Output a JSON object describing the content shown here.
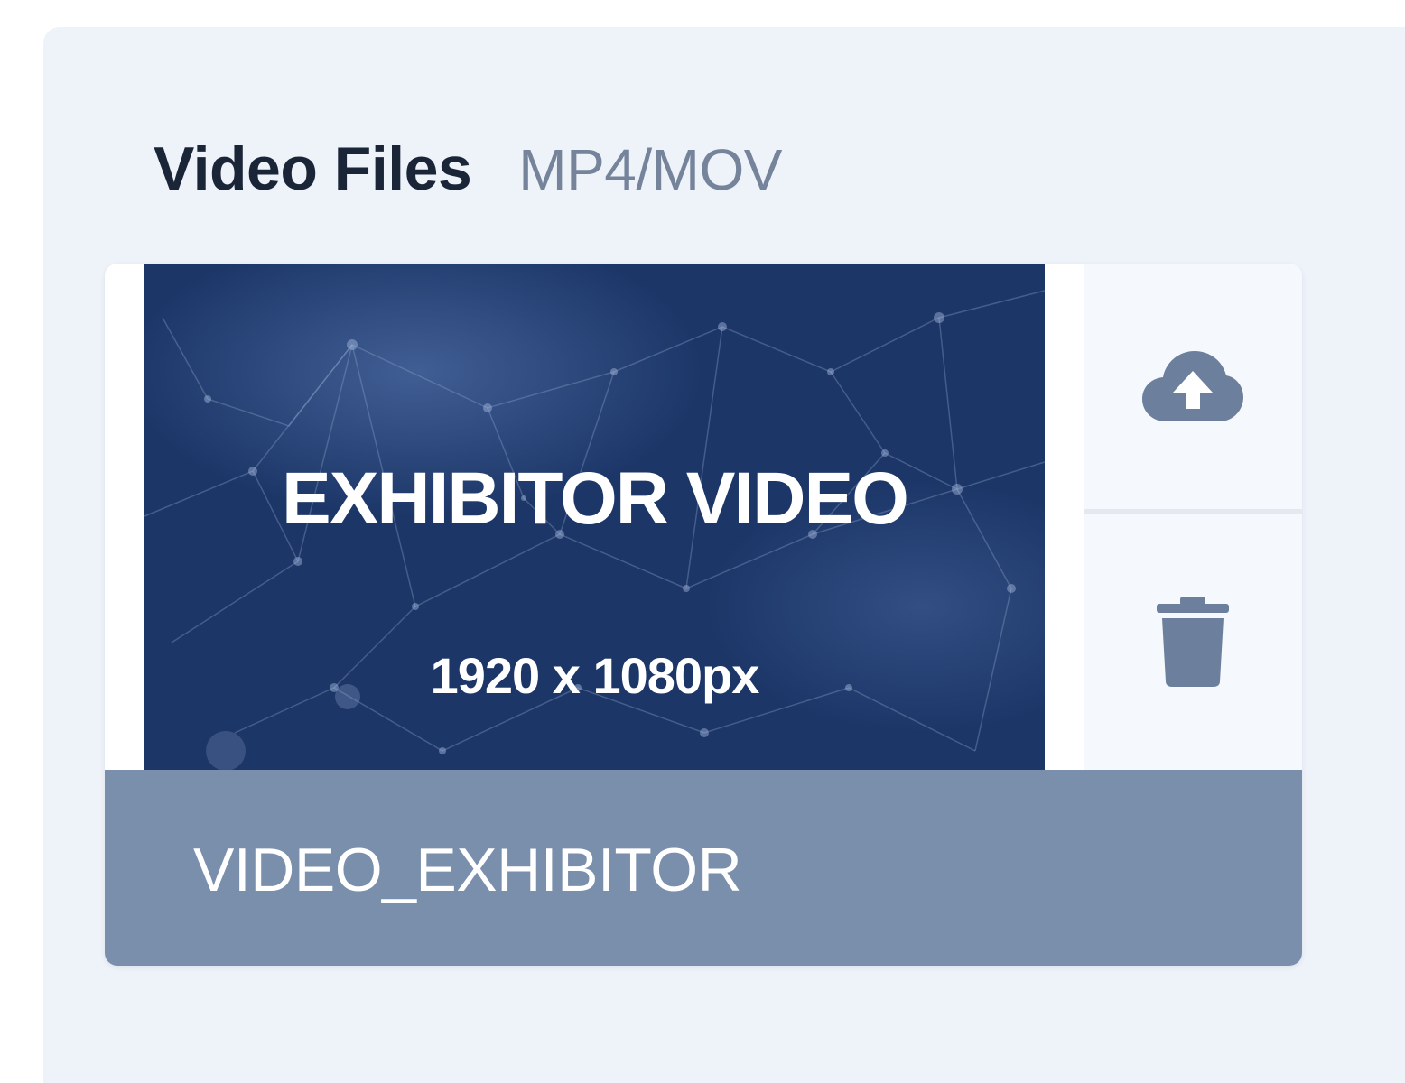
{
  "section": {
    "title": "Video Files",
    "formats": "MP4/MOV"
  },
  "file": {
    "thumbnail_title": "EXHIBITOR VIDEO",
    "thumbnail_resolution": "1920 x 1080px",
    "name": "VIDEO_EXHIBITOR"
  },
  "actions": {
    "upload_icon": "cloud-upload-icon",
    "delete_icon": "trash-icon"
  },
  "colors": {
    "panel_bg": "#eef2f9",
    "thumbnail_bg": "#1c3668",
    "caption_bg": "#7a8fab",
    "icon": "#6c809d",
    "title_text": "#1b2538",
    "subtitle_text": "#75849b"
  }
}
